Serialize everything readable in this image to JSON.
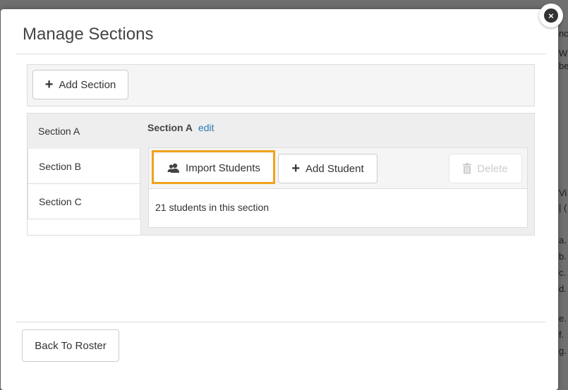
{
  "background": {
    "fragments": [
      "nc",
      "W",
      "be",
      "Vi",
      "| (",
      "a.",
      "b.",
      "c.",
      "d.",
      "e.",
      "f.",
      "g."
    ]
  },
  "modal": {
    "title": "Manage Sections",
    "close_glyph": "×",
    "add_section_label": "Add Section",
    "sections": [
      {
        "label": "Section A",
        "active": true
      },
      {
        "label": "Section B",
        "active": false
      },
      {
        "label": "Section C",
        "active": false
      }
    ],
    "current_section": {
      "name": "Section A",
      "edit_label": "edit",
      "import_label": "Import Students",
      "add_student_label": "Add Student",
      "delete_label": "Delete",
      "count_text": "21 students in this section"
    },
    "back_label": "Back To Roster"
  },
  "colors": {
    "highlight": "#f0a31c",
    "link": "#2a7ab5"
  }
}
